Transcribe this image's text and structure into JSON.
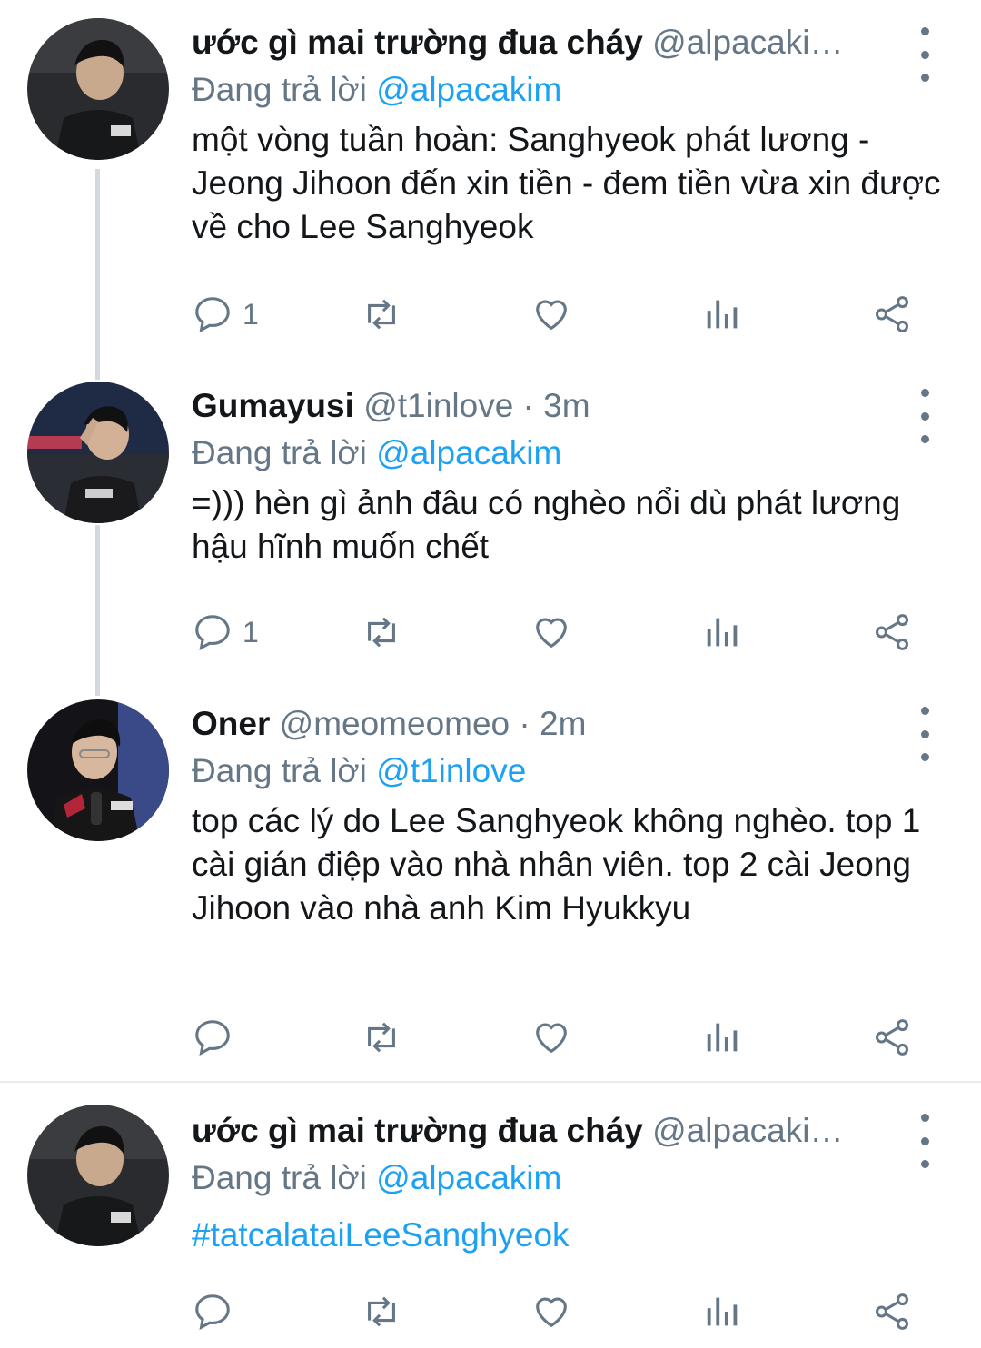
{
  "colors": {
    "link": "#1da1f2",
    "secondary_text": "#657786",
    "primary_text": "#14171a",
    "thread_line": "#d3d9de",
    "divider": "#e6ecf0"
  },
  "tweets": [
    {
      "name": "ước gì mai trường đua cháy",
      "handle": "@alpacaki…",
      "reply_prefix": "Đang trả lời",
      "reply_to": "@alpacakim",
      "text": "một vòng tuần hoàn: Sanghyeok phát lương - Jeong Jihoon đến xin tiền - đem tiền vừa xin được về cho Lee Sanghyeok",
      "reply_count": "1",
      "avatar": "user-photo-dark-jacket"
    },
    {
      "name": "Gumayusi",
      "handle": "@t1inlove · 3m",
      "reply_prefix": "Đang trả lời",
      "reply_to": "@alpacakim",
      "text": "=))) hèn gì ảnh đâu có nghèo nổi dù phát lương hậu hĩnh muốn chết",
      "reply_count": "1",
      "avatar": "user-photo-saluting"
    },
    {
      "name": "Oner",
      "handle": "@meomeomeo · 2m",
      "reply_prefix": "Đang trả lời",
      "reply_to": "@t1inlove",
      "text": "top các lý do Lee Sanghyeok không nghèo. top 1 cài gián điệp vào nhà nhân viên. top 2 cài Jeong Jihoon vào nhà anh Kim Hyukkyu",
      "reply_count": "",
      "avatar": "user-photo-with-microphone"
    },
    {
      "name": "ước gì mai trường đua cháy",
      "handle": "@alpacaki…",
      "reply_prefix": "Đang trả lời",
      "reply_to": "@alpacakim",
      "text": "#tatcalataiLeeSanghyeok",
      "reply_count": "",
      "avatar": "user-photo-dark-jacket"
    }
  ],
  "icons": {
    "reply": "reply-icon",
    "retweet": "retweet-icon",
    "like": "heart-icon",
    "analytics": "analytics-icon",
    "share": "share-icon",
    "more": "more-options-icon"
  }
}
